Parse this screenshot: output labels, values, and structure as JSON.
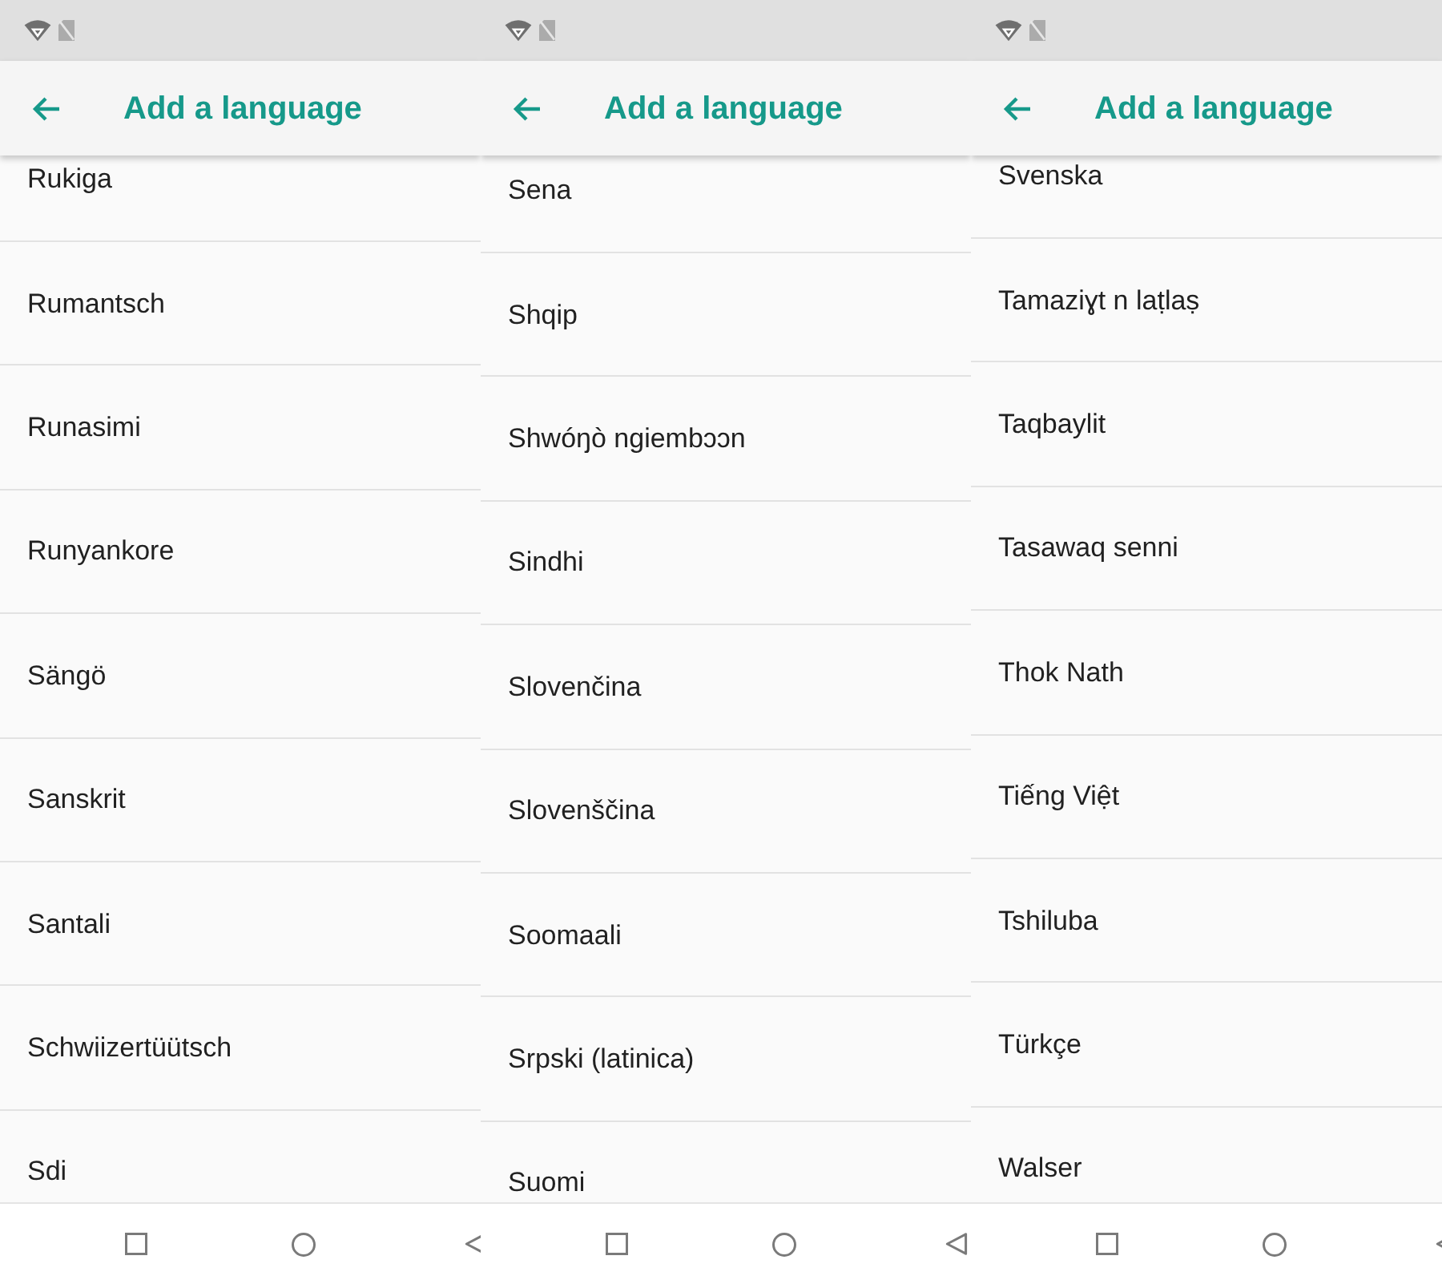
{
  "screens": [
    {
      "title": "Add a language",
      "languages": [
        "Rukiga",
        "Rumantsch",
        "Runasimi",
        "Runyankore",
        "Sängö",
        "Sanskrit",
        "Santali",
        "Schwiizertüütsch",
        "Sdi"
      ]
    },
    {
      "title": "Add a language",
      "languages": [
        "Sena",
        "Shqip",
        "Shwóŋò ngiembɔɔn",
        "Sindhi",
        "Slovenčina",
        "Slovenščina",
        "Soomaali",
        "Srpski (latinica)",
        "Suomi"
      ]
    },
    {
      "title": "Add a language",
      "languages": [
        "Svenska",
        "Tamaziɣt n laṭlaṣ",
        "Taqbaylit",
        "Tasawaq senni",
        "Thok Nath",
        "Tiếng Việt",
        "Tshiluba",
        "Türkçe",
        "Walser"
      ]
    }
  ]
}
